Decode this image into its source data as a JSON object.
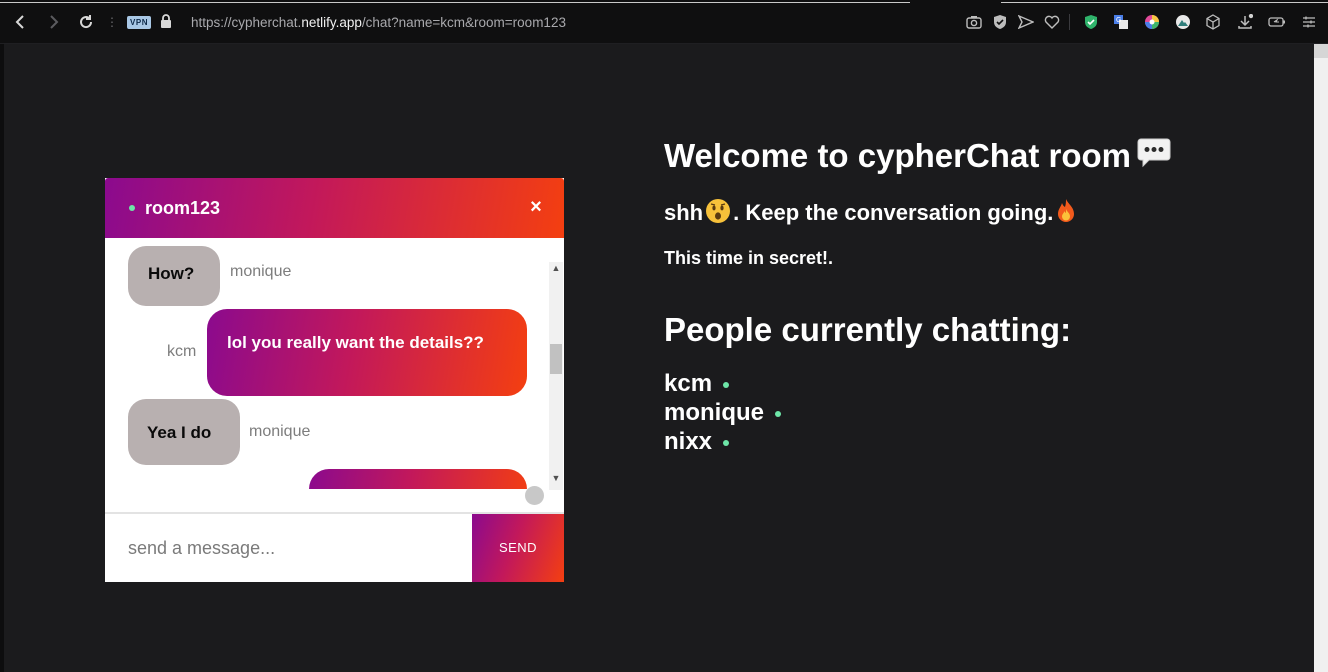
{
  "browser": {
    "vpn_label": "VPN",
    "url_prefix": "https://cypherchat.",
    "url_host": "netlify.app",
    "url_path": "/chat?name=kcm&room=room123"
  },
  "chat": {
    "room_name": "room123",
    "close_label": "×",
    "messages": [
      {
        "text": "How?",
        "sender": "monique",
        "mine": false
      },
      {
        "text": "lol you really want the details??",
        "sender": "kcm",
        "mine": true
      },
      {
        "text": "Yea I do",
        "sender": "monique",
        "mine": false
      }
    ],
    "composer": {
      "placeholder": "send a message...",
      "value": ""
    },
    "send_label": "SEND"
  },
  "welcome": {
    "title": "Welcome to cypherChat room",
    "tagline_prefix": "shh",
    "tagline_suffix": ". Keep the conversation going.",
    "secret": "This time in secret!."
  },
  "people": {
    "title": "People currently chatting:",
    "list": [
      "kcm",
      "monique",
      "nixx"
    ]
  },
  "colors": {
    "accent_start": "#8b0a8e",
    "accent_mid": "#c2185b",
    "accent_end": "#f43f10",
    "online": "#6ee6a8",
    "their_bubble": "#b8b0b0",
    "page_bg": "#1b1b1d"
  }
}
